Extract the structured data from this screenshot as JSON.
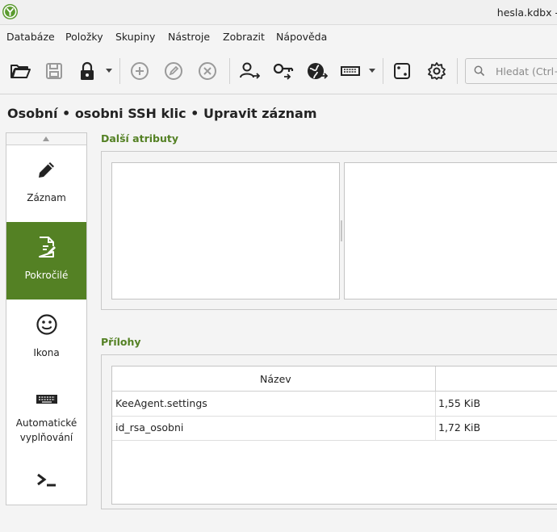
{
  "window": {
    "title": "hesla.kdbx -"
  },
  "menu": [
    {
      "label": "Databáze"
    },
    {
      "label": "Položky"
    },
    {
      "label": "Skupiny"
    },
    {
      "label": "Nástroje"
    },
    {
      "label": "Zobrazit"
    },
    {
      "label": "Nápověda"
    }
  ],
  "toolbar": {
    "icons": [
      "folder-open-icon",
      "save-icon",
      "lock-icon",
      "add-entry-icon",
      "edit-entry-icon",
      "delete-entry-icon",
      "copy-username-icon",
      "copy-password-icon",
      "copy-url-icon",
      "autotype-icon",
      "password-generator-icon",
      "settings-icon"
    ],
    "search_placeholder": "Hledat (Ctrl+F"
  },
  "page": {
    "title": "Osobní • osobni SSH klic • Upravit záznam"
  },
  "nav": [
    {
      "label": "Záznam",
      "icon": "pencil-icon",
      "active": false
    },
    {
      "label": "Pokročilé",
      "icon": "document-edit-icon",
      "active": true
    },
    {
      "label": "Ikona",
      "icon": "smiley-icon",
      "active": false
    },
    {
      "label": "Automatické vyplňování",
      "icon": "keyboard-icon",
      "active": false
    },
    {
      "label": "",
      "icon": "terminal-icon",
      "active": false
    }
  ],
  "sections": {
    "attributes_title": "Další atributy",
    "attachments_title": "Přílohy"
  },
  "attachments": {
    "columns": [
      "Název",
      ""
    ],
    "rows": [
      {
        "name": "KeeAgent.settings",
        "size": "1,55 KiB"
      },
      {
        "name": "id_rsa_osobni",
        "size": "1,72 KiB"
      }
    ]
  },
  "colors": {
    "accent": "#548124",
    "app_icon": "#5b9b2f"
  }
}
